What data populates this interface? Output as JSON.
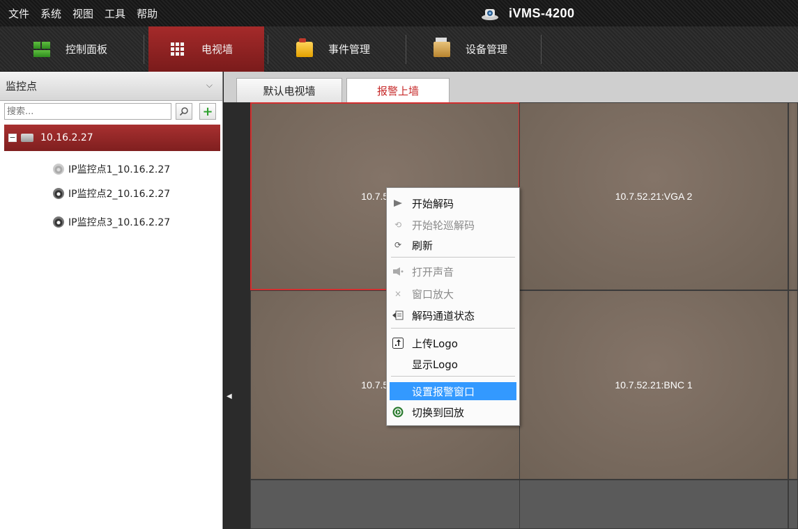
{
  "menubar": {
    "items": [
      "文件",
      "系统",
      "视图",
      "工具",
      "帮助"
    ],
    "app_title": "iVMS-4200"
  },
  "top_tabs": [
    {
      "label": "控制面板",
      "icon": "dashboard-icon",
      "active": false
    },
    {
      "label": "电视墙",
      "icon": "video-wall-icon",
      "active": true
    },
    {
      "label": "事件管理",
      "icon": "event-folder-icon",
      "active": false
    },
    {
      "label": "设备管理",
      "icon": "device-manager-icon",
      "active": false
    }
  ],
  "left_panel": {
    "header": "监控点",
    "search_placeholder": "搜索...",
    "tree": {
      "root": "10.16.2.27",
      "children": [
        "IP监控点1_10.16.2.27",
        "IP监控点2_10.16.2.27",
        "IP监控点3_10.16.2.27"
      ]
    }
  },
  "sub_tabs": [
    {
      "label": "默认电视墙",
      "active": false
    },
    {
      "label": "报警上墙",
      "active": true
    }
  ],
  "video_wall": {
    "cells": [
      {
        "label": "10.7.52.2",
        "selected": true
      },
      {
        "label": "10.7.52.21:VGA 2",
        "selected": false
      },
      {
        "label": "10.7.52.2",
        "selected": false
      },
      {
        "label": "10.7.52.21:BNC 1",
        "selected": false
      }
    ]
  },
  "context_menu": {
    "items": [
      {
        "label": "开始解码",
        "icon": "play-icon",
        "enabled": true
      },
      {
        "label": "开始轮巡解码",
        "icon": "cycle-icon",
        "enabled": false
      },
      {
        "label": "刷新",
        "icon": "refresh-icon",
        "enabled": true
      },
      {
        "label": "打开声音",
        "icon": "speaker-icon",
        "enabled": false
      },
      {
        "label": "窗口放大",
        "icon": "maximize-icon",
        "enabled": false
      },
      {
        "label": "解码通道状态",
        "icon": "status-icon",
        "enabled": true
      },
      {
        "label": "上传Logo",
        "icon": "upload-icon",
        "enabled": true
      },
      {
        "label": "显示Logo",
        "icon": "",
        "enabled": true
      },
      {
        "label": "设置报警窗口",
        "icon": "",
        "enabled": true,
        "highlighted": true
      },
      {
        "label": "切换到回放",
        "icon": "playback-icon",
        "enabled": true
      }
    ]
  },
  "colors": {
    "active_tab": "#a52a2a",
    "highlight": "#3399ff",
    "alarm_tab_text": "#c62828"
  }
}
